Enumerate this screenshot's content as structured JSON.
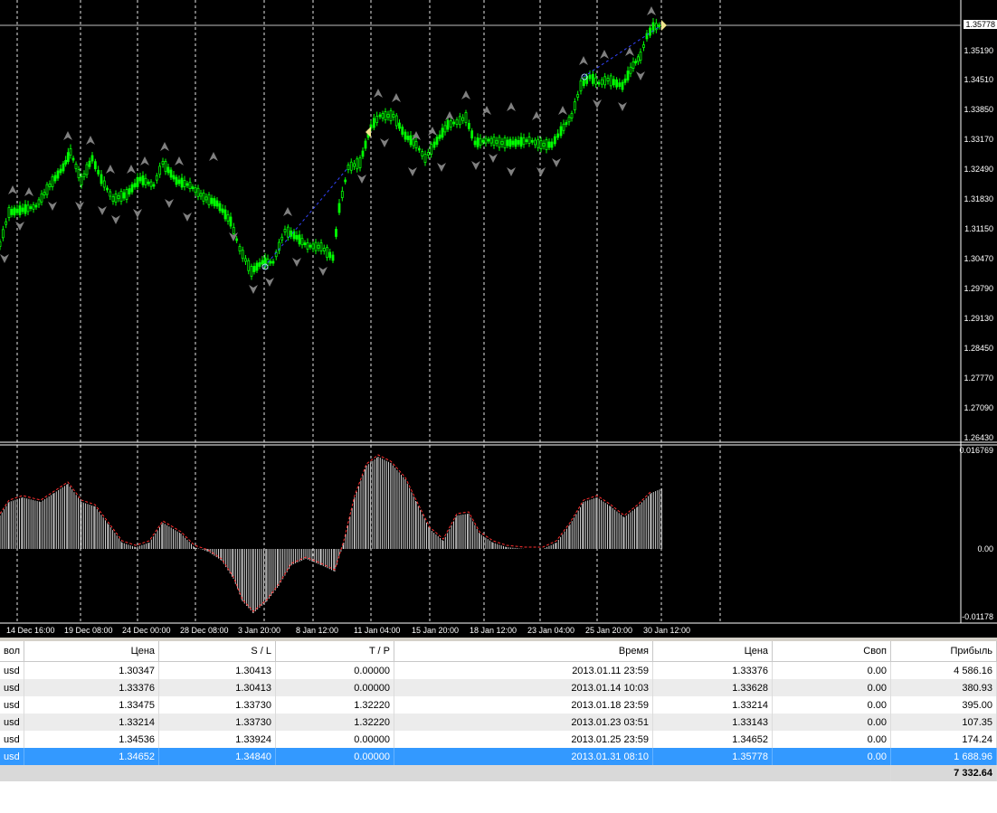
{
  "chart": {
    "price_labels": [
      "1.35778",
      "1.35190",
      "1.34510",
      "1.33850",
      "1.33170",
      "1.32490",
      "1.31830",
      "1.31150",
      "1.30470",
      "1.29790",
      "1.29130",
      "1.28450",
      "1.27770",
      "1.27090",
      "1.26430"
    ],
    "current_price": "1.35778",
    "indicator_labels": {
      "top": "0.016769",
      "zero": "0.00",
      "bottom": "-0.01178"
    },
    "time_labels": [
      "14 Dec 16:00",
      "19 Dec 08:00",
      "24 Dec 00:00",
      "28 Dec 08:00",
      "3 Jan 20:00",
      "8 Jan 12:00",
      "11 Jan 04:00",
      "15 Jan 20:00",
      "18 Jan 12:00",
      "23 Jan 04:00",
      "25 Jan 20:00",
      "30 Jan 12:00"
    ],
    "colors": {
      "bull": "#00ff00",
      "bear": "#ffffff",
      "grid": "#ffffff",
      "signal": "#ff3030",
      "fractal": "#808080",
      "selected_row": "#3399ff"
    }
  },
  "table": {
    "headers": [
      "вол",
      "Цена",
      "S / L",
      "T / P",
      "Время",
      "Цена",
      "Своп",
      "Прибыль"
    ],
    "rows": [
      [
        "usd",
        "1.30347",
        "1.30413",
        "0.00000",
        "2013.01.11 23:59",
        "1.33376",
        "0.00",
        "4 586.16"
      ],
      [
        "usd",
        "1.33376",
        "1.30413",
        "0.00000",
        "2013.01.14 10:03",
        "1.33628",
        "0.00",
        "380.93"
      ],
      [
        "usd",
        "1.33475",
        "1.33730",
        "1.32220",
        "2013.01.18 23:59",
        "1.33214",
        "0.00",
        "395.00"
      ],
      [
        "usd",
        "1.33214",
        "1.33730",
        "1.32220",
        "2013.01.23 03:51",
        "1.33143",
        "0.00",
        "107.35"
      ],
      [
        "usd",
        "1.34536",
        "1.33924",
        "0.00000",
        "2013.01.25 23:59",
        "1.34652",
        "0.00",
        "174.24"
      ],
      [
        "usd",
        "1.34652",
        "1.34840",
        "0.00000",
        "2013.01.31 08:10",
        "1.35778",
        "0.00",
        "1 688.96"
      ]
    ],
    "total": "7 332.64"
  }
}
